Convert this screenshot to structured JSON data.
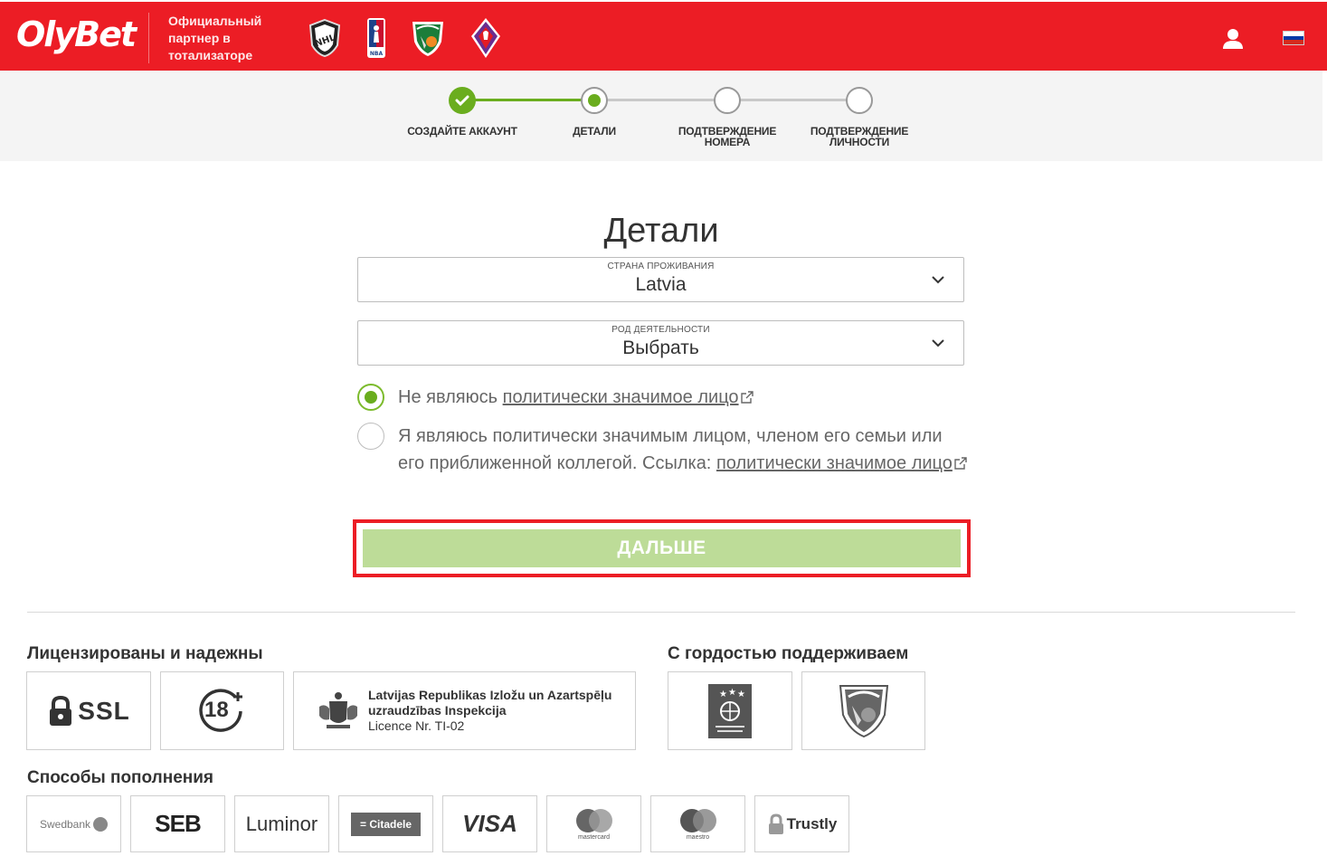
{
  "header": {
    "logo_text": "OlyBet",
    "partner_text": "Официальный партнер в тотализаторе",
    "team_logos": [
      {
        "icon": "nhl-logo-icon"
      },
      {
        "icon": "nba-logo-icon",
        "caption": "NBA"
      },
      {
        "icon": "zalgiris-logo-icon"
      },
      {
        "icon": "fiorentina-logo-icon"
      }
    ],
    "user_icon": "user-icon",
    "language_flag": "russian-flag-icon"
  },
  "stepper": {
    "steps": [
      {
        "label": "СОЗДАЙТЕ АККАУНТ",
        "state": "completed"
      },
      {
        "label": "ДЕТАЛИ",
        "state": "current"
      },
      {
        "label": "ПОДТВЕРЖДЕНИЕ НОМЕРА",
        "state": "pending"
      },
      {
        "label": "ПОДТВЕРЖДЕНИЕ ЛИЧНОСТИ",
        "state": "pending"
      }
    ]
  },
  "form": {
    "title": "Детали",
    "country": {
      "caption": "СТРАНА ПРОЖИВАНИЯ",
      "value": "Latvia"
    },
    "occupation": {
      "caption": "РОД ДЕЯТЕЛЬНОСТИ",
      "value": "Выбрать"
    },
    "pep_options": [
      {
        "text": "Не являюсь ",
        "link": "политически значимое лицо",
        "checked": true
      },
      {
        "text": "Я являюсь политически значимым лицом, членом его семьи или его приближенной коллегой. Ссылка: ",
        "link": "политически значимое лицо",
        "checked": false
      }
    ],
    "next_button": "ДАЛЬШЕ"
  },
  "footer": {
    "licensed_title": "Лицензированы и надежны",
    "supported_title": "С гордостью поддерживаем",
    "deposit_title": "Способы пополнения",
    "ssl_label": "SSL",
    "age_label": "18",
    "license": {
      "line1": "Latvijas Republikas Izložu un Azartspēļu",
      "line2": "uzraudzības Inspekcija",
      "line3": "Licence Nr. TI-02"
    },
    "payments": {
      "swedbank": "Swedbank",
      "seb": "SEB",
      "luminor": "Luminor",
      "citadele": "Citadele",
      "visa": "VISA",
      "mastercard": "mastercard",
      "maestro": "maestro",
      "trustly": "Trustly"
    }
  },
  "colors": {
    "brand_red": "#ec1d25",
    "step_green": "#6aad1e",
    "button_green": "#bddc98"
  }
}
